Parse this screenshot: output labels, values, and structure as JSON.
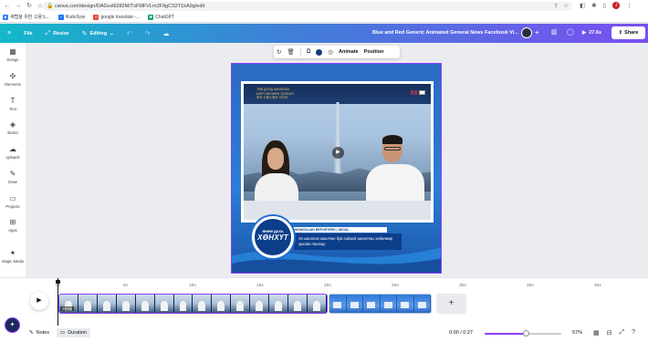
{
  "browser": {
    "url": "canva.com/design/DAGvvl6282M/TxFMFVLm3F9gCS2T1kA9g/edit",
    "nav": [
      "←",
      "→",
      "↻",
      "⌂"
    ],
    "bookmarks": [
      {
        "label": "새탭을 위한 고용노..."
      },
      {
        "label": "Фэйсбүүк"
      },
      {
        "label": "google translate -..."
      },
      {
        "label": "ChatGPT"
      }
    ],
    "profile_initial": "J"
  },
  "header": {
    "menu_icon": "≡",
    "file_label": "File",
    "resize_label": "Resize",
    "editing_label": "Editing",
    "design_title": "Blue and Red Generic Animated General News Facebook Vi...",
    "play_time": "27.6s",
    "share_label": "Share"
  },
  "sidebar": {
    "items": [
      {
        "label": "Design",
        "icon": "▦"
      },
      {
        "label": "Elements",
        "icon": "✣"
      },
      {
        "label": "Text",
        "icon": "T"
      },
      {
        "label": "Brand",
        "icon": "◈"
      },
      {
        "label": "Uploads",
        "icon": "☁"
      },
      {
        "label": "Draw",
        "icon": "✎"
      },
      {
        "label": "Projects",
        "icon": "▭"
      },
      {
        "label": "Apps",
        "icon": "⊞"
      },
      {
        "label": "Magic Media",
        "icon": "✦"
      }
    ]
  },
  "toolbar": {
    "animate_label": "Animate",
    "position_label": "Position",
    "color": "#0f3d7a"
  },
  "design": {
    "banner_line1": "ТӨВ ДЭЭД АЖИЛЛАХ",
    "banner_line2": "МЭРГЭЖЛИЙН ХОЛБОО",
    "banner_line3": "한국 고용노동부 미디어",
    "badge_sub": "ӨНӨӨ ДАХЬ",
    "badge_main": "ХӨНХҮТ",
    "date_strip": "MONGOLIAN REPORTERS | SEOUL",
    "caption": "Ээ ажиллах ажилчин буй гадаад ажилтны хөдөлмөр эрхийн талаар"
  },
  "timeline": {
    "ticks": [
      "0s",
      "5s",
      "10s",
      "15s",
      "20s",
      "25s",
      "30s",
      "35s",
      "40s"
    ],
    "clip_a_duration": "20.0s",
    "clip_a_count": 14,
    "clip_b_count": 6,
    "add_label": "+"
  },
  "bottom": {
    "notes_label": "Notes",
    "duration_label": "Duration",
    "time": "0:00 / 0:27",
    "zoom": "57%",
    "zoom_fraction": 0.57
  },
  "colors": {
    "accent": "#8b3dff",
    "brand_blue": "#0c3e8a"
  }
}
